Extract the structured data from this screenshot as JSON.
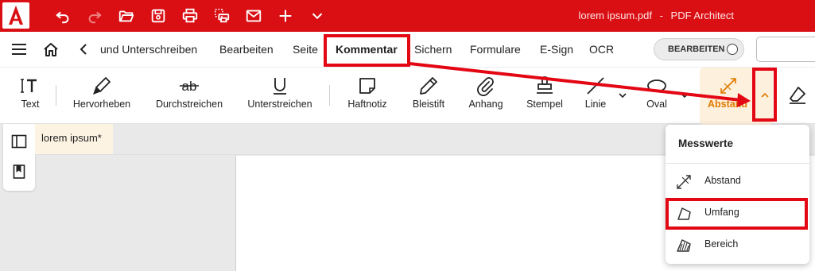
{
  "titlebar": {
    "doc_name": "lorem ipsum.pdf",
    "separator": "-",
    "app_name": "PDF Architect",
    "icons": [
      "undo-icon",
      "redo-icon",
      "open-folder-icon",
      "save-icon",
      "print-icon",
      "scan-print-icon",
      "mail-icon",
      "plus-icon",
      "chevron-down-icon"
    ]
  },
  "tabs": [
    {
      "label": "und Unterschreiben"
    },
    {
      "label": "Bearbeiten"
    },
    {
      "label": "Seite"
    },
    {
      "label": "Kommentar"
    },
    {
      "label": "Sichern"
    },
    {
      "label": "Formulare"
    },
    {
      "label": "E-Sign"
    },
    {
      "label": "OCR"
    }
  ],
  "edit_toggle": {
    "label": "BEARBEITEN"
  },
  "ribbon": {
    "tools": [
      {
        "label": "Text",
        "icon": "text-cursor-icon"
      },
      {
        "label": "Hervorheben",
        "icon": "highlighter-icon"
      },
      {
        "label": "Durchstreichen",
        "icon": "strikethrough-icon"
      },
      {
        "label": "Unterstreichen",
        "icon": "underline-icon"
      },
      {
        "label": "Haftnotiz",
        "icon": "sticky-note-icon"
      },
      {
        "label": "Bleistift",
        "icon": "pencil-icon"
      },
      {
        "label": "Anhang",
        "icon": "paperclip-icon"
      },
      {
        "label": "Stempel",
        "icon": "stamp-icon"
      },
      {
        "label": "Linie",
        "icon": "line-icon"
      },
      {
        "label": "Oval",
        "icon": "oval-icon"
      },
      {
        "label": "Abstand",
        "icon": "distance-measure-icon"
      }
    ]
  },
  "document": {
    "tab_label": "lorem ipsum",
    "modified_marker": "*"
  },
  "menu": {
    "title": "Messwerte",
    "items": [
      {
        "label": "Abstand",
        "icon": "distance-measure-icon"
      },
      {
        "label": "Umfang",
        "icon": "perimeter-icon"
      },
      {
        "label": "Bereich",
        "icon": "area-icon"
      }
    ]
  },
  "colors": {
    "brand_red": "#d90f14",
    "highlight_red": "#e30613",
    "active_orange": "#e07b00",
    "active_bg": "#fdf0dc"
  }
}
